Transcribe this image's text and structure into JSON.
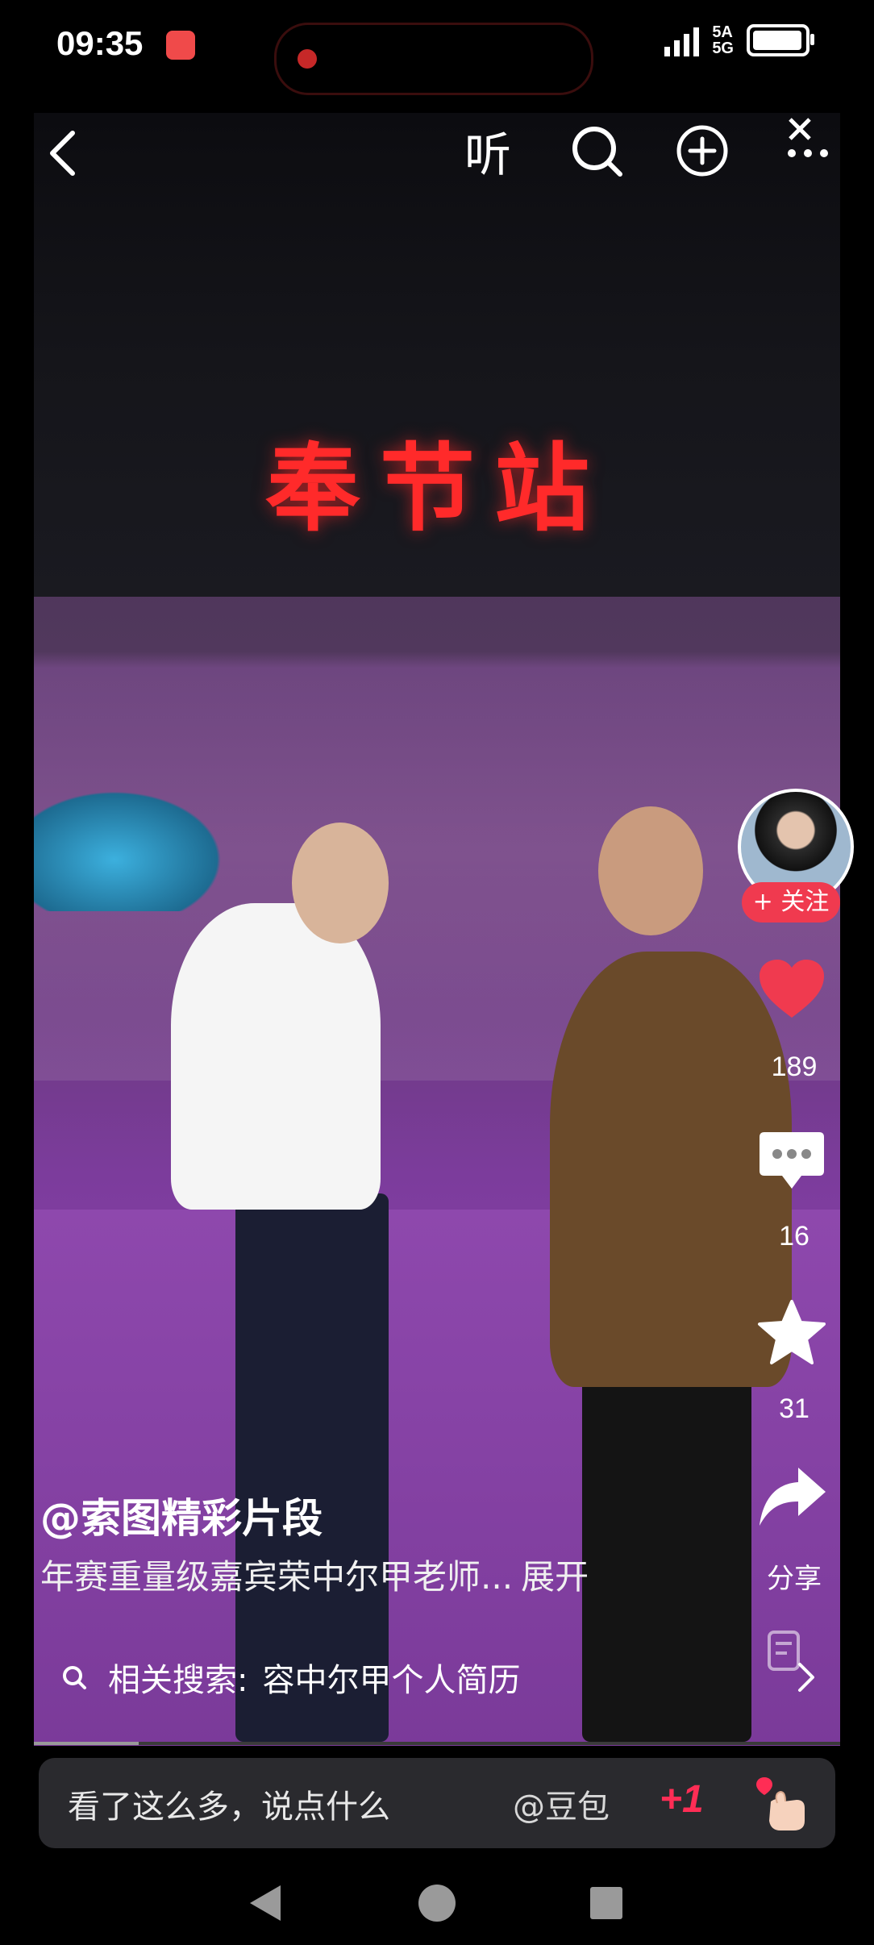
{
  "status_bar": {
    "time": "09:35",
    "network_top": "5A",
    "network_bottom": "5G"
  },
  "top_bar": {
    "listen_label": "听"
  },
  "video": {
    "stage_sign": "奉节站",
    "progress": 0.13
  },
  "side_rail": {
    "follow_label": "+ 关注",
    "like_count": "189",
    "comment_count": "16",
    "favorite_count": "31",
    "share_label": "分享"
  },
  "caption": {
    "author": "@索图精彩片段",
    "description": "年赛重量级嘉宾荣中尔甲老师...",
    "expand_label": "展开"
  },
  "related_search": {
    "prefix": "相关搜索:",
    "query": "容中尔甲个人简历"
  },
  "comment_bar": {
    "placeholder": "看了这么多，说点什么",
    "mention": "@豆包",
    "plus_one": "+1"
  },
  "colors": {
    "like_red": "#f03a4f",
    "plus_one": "#ff2d55",
    "sign_red": "#ff2a2a"
  }
}
